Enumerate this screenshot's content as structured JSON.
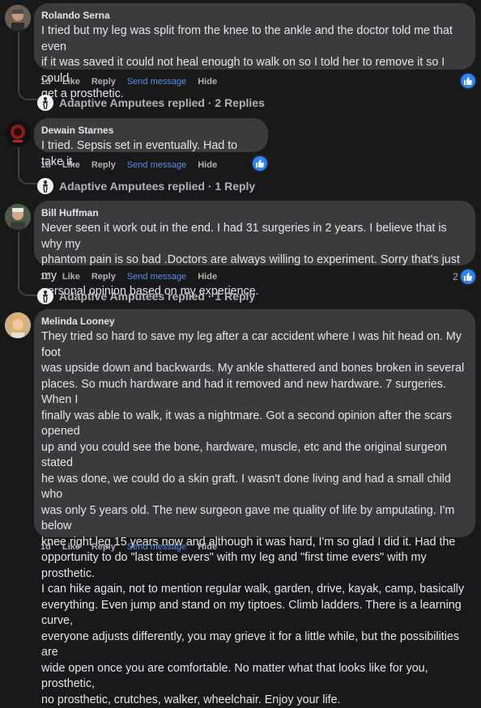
{
  "comments": [
    {
      "author": "Rolando Serna",
      "text": "I tried but my leg was split from the knee to the ankle and the doctor told me that even\nif it was saved it could not heal enough to walk on so I told her to remove it so I could\nget a prosthetic.",
      "time": "1d",
      "like": "Like",
      "reply": "Reply",
      "send": "Send message",
      "hide": "Hide",
      "reactions": ""
    },
    {
      "author": "Dewain Starnes",
      "text": "I tried. Sepsis set in eventually. Had to take it.",
      "time": "1d",
      "like": "Like",
      "reply": "Reply",
      "send": "Send message",
      "hide": "Hide",
      "reactions": ""
    },
    {
      "author": "Bill Huffman",
      "text": "Never seen it work out in the end. I had 31 surgeries in 2 years. I believe that is why my\nphantom pain is so bad .Doctors are always willing to experiment. Sorry that's just my\npersonal opinion based on my experience.",
      "time": "1d",
      "like": "Like",
      "reply": "Reply",
      "send": "Send message",
      "hide": "Hide",
      "reactions": "2"
    },
    {
      "author": "Melinda Looney",
      "text": "They tried so hard to save my leg after a car accident where I was hit head on. My foot\nwas upside down and backwards. My ankle shattered and bones broken in several\nplaces. So much hardware and had it removed and new hardware. 7 surgeries. When I\nfinally was able to walk, it was a nightmare. Got a second opinion after the scars opened\nup and you could see the bone, hardware, muscle, etc and the original surgeon stated\nhe was done, we could do a skin graft. I wasn't done living and had a small child who\nwas only 5 years old. The new surgeon gave me quality of life by amputating. I'm below\nknee right leg 15 years now and although it was hard, I'm so glad I did it. Had the\nopportunity to do \"last time evers\" with my leg and \"first time evers\" with my prosthetic.\nI can hike again, not to mention regular walk, garden, drive, kayak, camp, basically\neverything. Even jump and stand on my tiptoes. Climb ladders. There is a learning curve,\neveryone adjusts differently, you may grieve it for a little while, but the possibilities are\nwide open once you are comfortable. No matter what that looks like for you, prosthetic,\nno prosthetic, crutches, walker, wheelchair. Enjoy your life.",
      "time": "1d",
      "like": "Like",
      "reply": "Reply",
      "send": "Send message",
      "hide": "Hide",
      "reactions": ""
    }
  ],
  "reply_threads": [
    {
      "label": "Adaptive Amputees replied · 2 Replies"
    },
    {
      "label": "Adaptive Amputees replied · 1 Reply"
    },
    {
      "label": "Adaptive Amputees replied · 1 Reply"
    }
  ],
  "colors": {
    "background": "#18191a",
    "bubble": "#3a3b3c",
    "link": "#5d8fe8",
    "like_blue": "#2d86ff"
  },
  "icons": {
    "reaction": "thumbs-up-icon",
    "page_avatar": "adaptive-amputees-logo"
  }
}
